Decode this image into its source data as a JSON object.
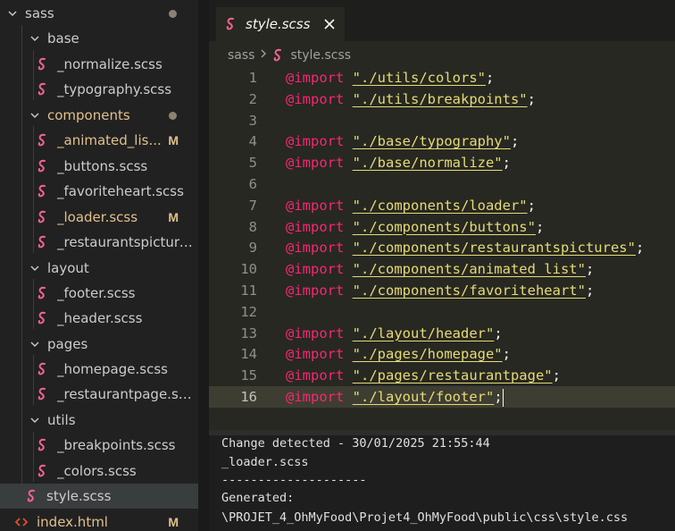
{
  "explorer": {
    "root": "sass",
    "folders": {
      "base": "base",
      "components": "components",
      "layout": "layout",
      "pages": "pages",
      "utils": "utils"
    },
    "files": {
      "normalize": "_normalize.scss",
      "typography": "_typography.scss",
      "animated_list": "_animated_lis...",
      "buttons": "_buttons.scss",
      "favoriteheart": "_favoriteheart.scss",
      "loader": "_loader.scss",
      "restaurantspictures": "_restaurantspicture...",
      "footer": "_footer.scss",
      "header": "_header.scss",
      "homepage": "_homepage.scss",
      "restaurantpage": "_restaurantpage.scss",
      "breakpoints": "_breakpoints.scss",
      "colors": "_colors.scss",
      "style": "style.scss",
      "index": "index.html"
    },
    "badges": {
      "modified": "M"
    }
  },
  "editor": {
    "tab_label": "style.scss",
    "breadcrumb": [
      "sass",
      "style.scss"
    ],
    "lines": [
      {
        "n": "1",
        "kw": "@import",
        "str": "\"./utils/colors\"",
        "end": ";"
      },
      {
        "n": "2",
        "kw": "@import",
        "str": "\"./utils/breakpoints\"",
        "end": ";"
      },
      {
        "n": "3",
        "kw": "",
        "str": "",
        "end": ""
      },
      {
        "n": "4",
        "kw": "@import",
        "str": "\"./base/typography\"",
        "end": ";"
      },
      {
        "n": "5",
        "kw": "@import",
        "str": "\"./base/normalize\"",
        "end": ";"
      },
      {
        "n": "6",
        "kw": "",
        "str": "",
        "end": ""
      },
      {
        "n": "7",
        "kw": "@import",
        "str": "\"./components/loader\"",
        "end": ";"
      },
      {
        "n": "8",
        "kw": "@import",
        "str": "\"./components/buttons\"",
        "end": ";"
      },
      {
        "n": "9",
        "kw": "@import",
        "str": "\"./components/restaurantspictures\"",
        "end": ";"
      },
      {
        "n": "10",
        "kw": "@import",
        "str": "\"./components/animated_list\"",
        "end": ";"
      },
      {
        "n": "11",
        "kw": "@import",
        "str": "\"./components/favoriteheart\"",
        "end": ";"
      },
      {
        "n": "12",
        "kw": "",
        "str": "",
        "end": ""
      },
      {
        "n": "13",
        "kw": "@import",
        "str": "\"./layout/header\"",
        "end": ";"
      },
      {
        "n": "14",
        "kw": "@import",
        "str": "\"./pages/homepage\"",
        "end": ";"
      },
      {
        "n": "15",
        "kw": "@import",
        "str": "\"./pages/restaurantpage\"",
        "end": ";"
      },
      {
        "n": "16",
        "kw": "@import",
        "str": "\"./layout/footer\"",
        "end": ";"
      }
    ]
  },
  "terminal": {
    "lines": [
      "Change detected - 30/01/2025 21:55:44",
      "_loader.scss",
      "--------------------",
      "Generated:",
      "\\PROJET_4_OhMyFood\\Projet4_OhMyFood\\public\\css\\style.css"
    ]
  },
  "colors": {
    "sass_icon": "#f06292",
    "html_icon": "#e44d26",
    "keyword": "#f92672",
    "string": "#e6db74",
    "modified": "#e2c08d"
  }
}
